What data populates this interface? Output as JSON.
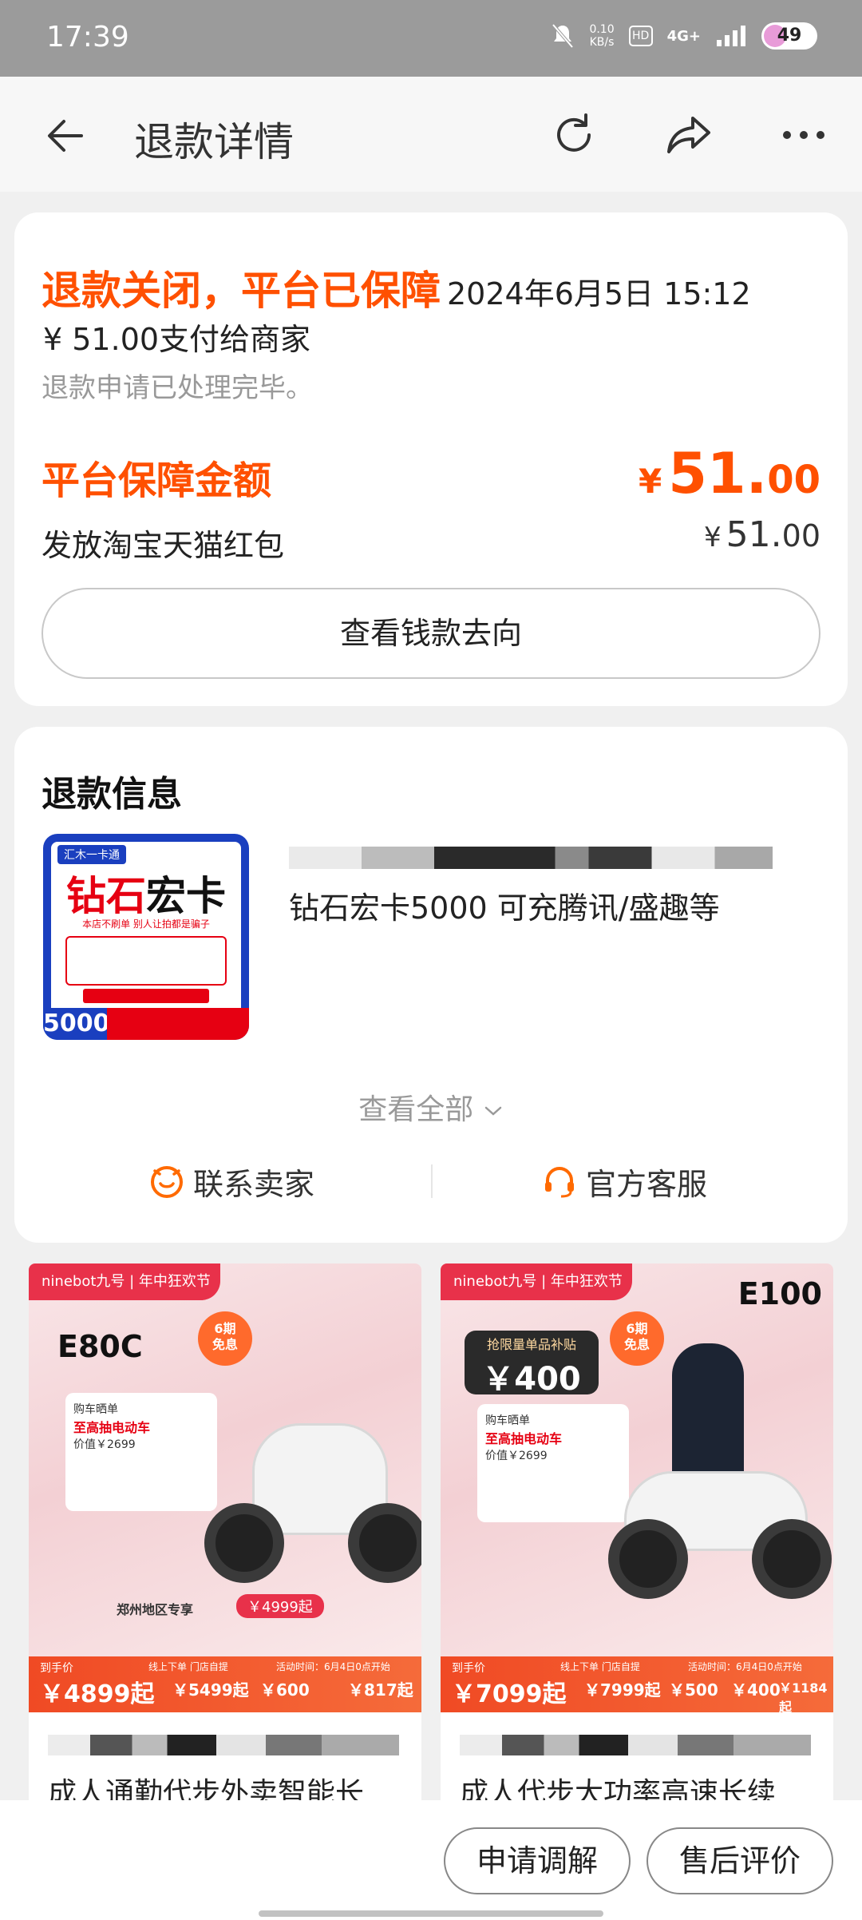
{
  "status_bar": {
    "time": "17:39",
    "net_speed": "0.10\nKB/s",
    "hd": "HD",
    "network": "4G+",
    "battery": "49"
  },
  "nav": {
    "title": "退款详情",
    "icons": [
      "back-arrow-icon",
      "refresh-icon",
      "share-icon",
      "more-icon"
    ]
  },
  "refund_status": {
    "title": "退款关闭，平台已保障",
    "date": "2024年6月5日 15:12",
    "pay_line": "¥ 51.00支付给商家",
    "done_line": "退款申请已处理完毕。",
    "guard_label": "平台保障金额",
    "guard_currency": "¥",
    "guard_int": "51.",
    "guard_dec": "00",
    "red_label": "发放淘宝天猫红包",
    "red_currency": "¥",
    "red_int": "51.",
    "red_dec": "00",
    "money_button": "查看钱款去向"
  },
  "refund_info": {
    "title": "退款信息",
    "thumb": {
      "tag": "汇木一卡通",
      "big_a": "钻石",
      "big_b": "宏卡",
      "sub": "本店不刷单 别人让拍都是骗子",
      "num": "5000"
    },
    "product_title": "钻石宏卡5000 可充腾讯/盛趣等",
    "view_all": "查看全部",
    "contact_seller": "联系卖家",
    "official_service": "官方客服"
  },
  "products": [
    {
      "brand": "ninebot九号 | 年中狂欢节",
      "model": "E80C",
      "badge": "6期\n免息",
      "info_title": "购车晒单",
      "info_hl": "至高抽电动车",
      "info_price": "价值￥2699",
      "region": "郑州地区专享",
      "chip": "￥4999起",
      "price_label": "到手价",
      "price": "￥4899起",
      "retail": "￥5499起",
      "discount": "￥600",
      "monthly": "￥817起",
      "promo_line": "线上下单 门店自提",
      "activity": "活动时间：6月4日0点开始",
      "name": "成人通勤代步外卖智能长"
    },
    {
      "brand": "ninebot九号 | 年中狂欢节",
      "model": "E100",
      "badge": "6期\n免息",
      "promo_title": "抢限量单品补贴",
      "promo_value": "￥400",
      "info_title": "购车晒单",
      "info_hl": "至高抽电动车",
      "info_price": "价值￥2699",
      "price_label": "到手价",
      "price": "￥7099起",
      "retail": "￥7999起",
      "discount": "￥500",
      "limited": "￥400",
      "monthly": "￥1184起",
      "promo_line": "线上下单 门店自提",
      "activity": "活动时间：6月4日0点开始",
      "name": "成人代步大功率高速长续"
    }
  ],
  "bottom_bar": {
    "mediate": "申请调解",
    "review": "售后评价"
  },
  "colors": {
    "accent": "#ff5000",
    "brand_red": "#e8314a"
  }
}
